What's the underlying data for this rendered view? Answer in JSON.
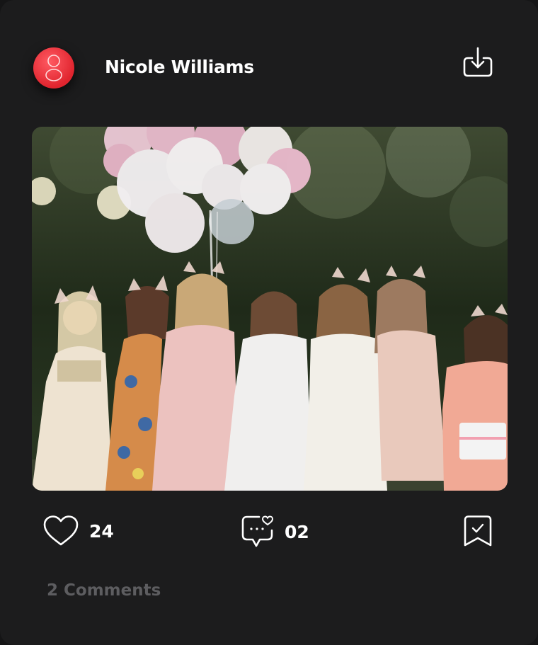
{
  "post": {
    "author": "Nicole Williams",
    "likes": "24",
    "comments_count": "02",
    "comments_label": "2 Comments"
  },
  "icons": {
    "avatar": "user-icon",
    "download": "download-icon",
    "like": "heart-icon",
    "comment": "comment-bubble-icon",
    "save": "bookmark-check-icon"
  },
  "colors": {
    "background": "#1c1c1d",
    "avatar_accent": "#e0242e",
    "text_primary": "#ffffff",
    "text_muted": "#5d5d60"
  }
}
